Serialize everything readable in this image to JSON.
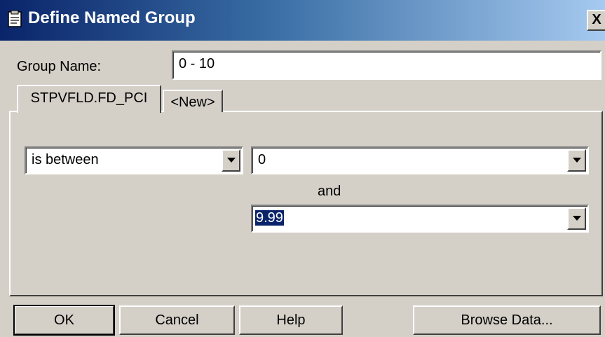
{
  "window": {
    "title": "Define Named Group",
    "close_glyph": "X",
    "icon": "document-icon"
  },
  "group_name": {
    "label": "Group Name:",
    "value": "0 - 10"
  },
  "tabs": [
    {
      "label": "STPVFLD.FD_PCI",
      "active": true
    },
    {
      "label": "<New>",
      "active": false
    }
  ],
  "condition": {
    "operator": "is between",
    "value_from": "0",
    "connector": "and",
    "value_to": "9.99"
  },
  "buttons": {
    "ok": "OK",
    "cancel": "Cancel",
    "help": "Help",
    "browse": "Browse Data..."
  },
  "colors": {
    "titlebar_start": "#0a246a",
    "titlebar_end": "#a6caf0",
    "dialog_bg": "#d4d0c8",
    "selection": "#0a246a"
  }
}
